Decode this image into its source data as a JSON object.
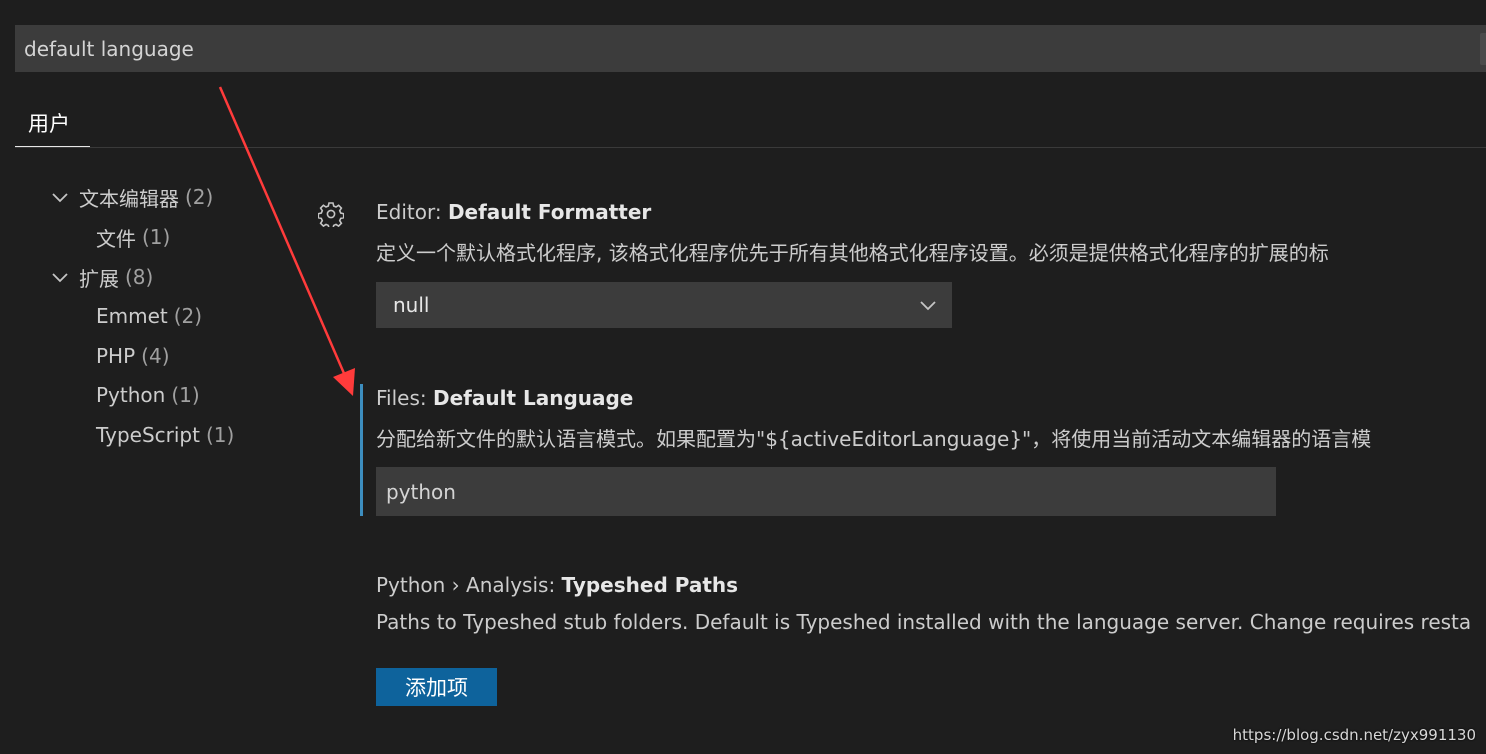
{
  "search": {
    "value": "default language"
  },
  "scope_tab": {
    "label": "用户"
  },
  "toc": {
    "items": [
      {
        "label": "文本编辑器",
        "count": "(2)",
        "expanded": true,
        "level": 0
      },
      {
        "label": "文件",
        "count": "(1)",
        "level": 1
      },
      {
        "label": "扩展",
        "count": "(8)",
        "expanded": true,
        "level": 0
      },
      {
        "label": "Emmet",
        "count": "(2)",
        "level": 1
      },
      {
        "label": "PHP",
        "count": "(4)",
        "level": 1
      },
      {
        "label": "Python",
        "count": "(1)",
        "level": 1
      },
      {
        "label": "TypeScript",
        "count": "(1)",
        "level": 1
      }
    ]
  },
  "settings": {
    "default_formatter": {
      "category": "Editor: ",
      "name": "Default Formatter",
      "description": "定义一个默认格式化程序, 该格式化程序优先于所有其他格式化程序设置。必须是提供格式化程序的扩展的标",
      "value": "null"
    },
    "default_language": {
      "category": "Files: ",
      "name": "Default Language",
      "description": "分配给新文件的默认语言模式。如果配置为\"${activeEditorLanguage}\"，将使用当前活动文本编辑器的语言模",
      "value": "python"
    },
    "typeshed_paths": {
      "category": "Python › Analysis: ",
      "name": "Typeshed Paths",
      "description": "Paths to Typeshed stub folders. Default is Typeshed installed with the language server. Change requires resta",
      "button_label": "添加项"
    }
  },
  "watermark": "https://blog.csdn.net/zyx991130",
  "colors": {
    "background": "#1e1e1e",
    "input_background": "#3c3c3c",
    "focus_bar": "#3d8ebf",
    "button_background": "#0e639c",
    "annotation_arrow": "#ff3b3b"
  }
}
